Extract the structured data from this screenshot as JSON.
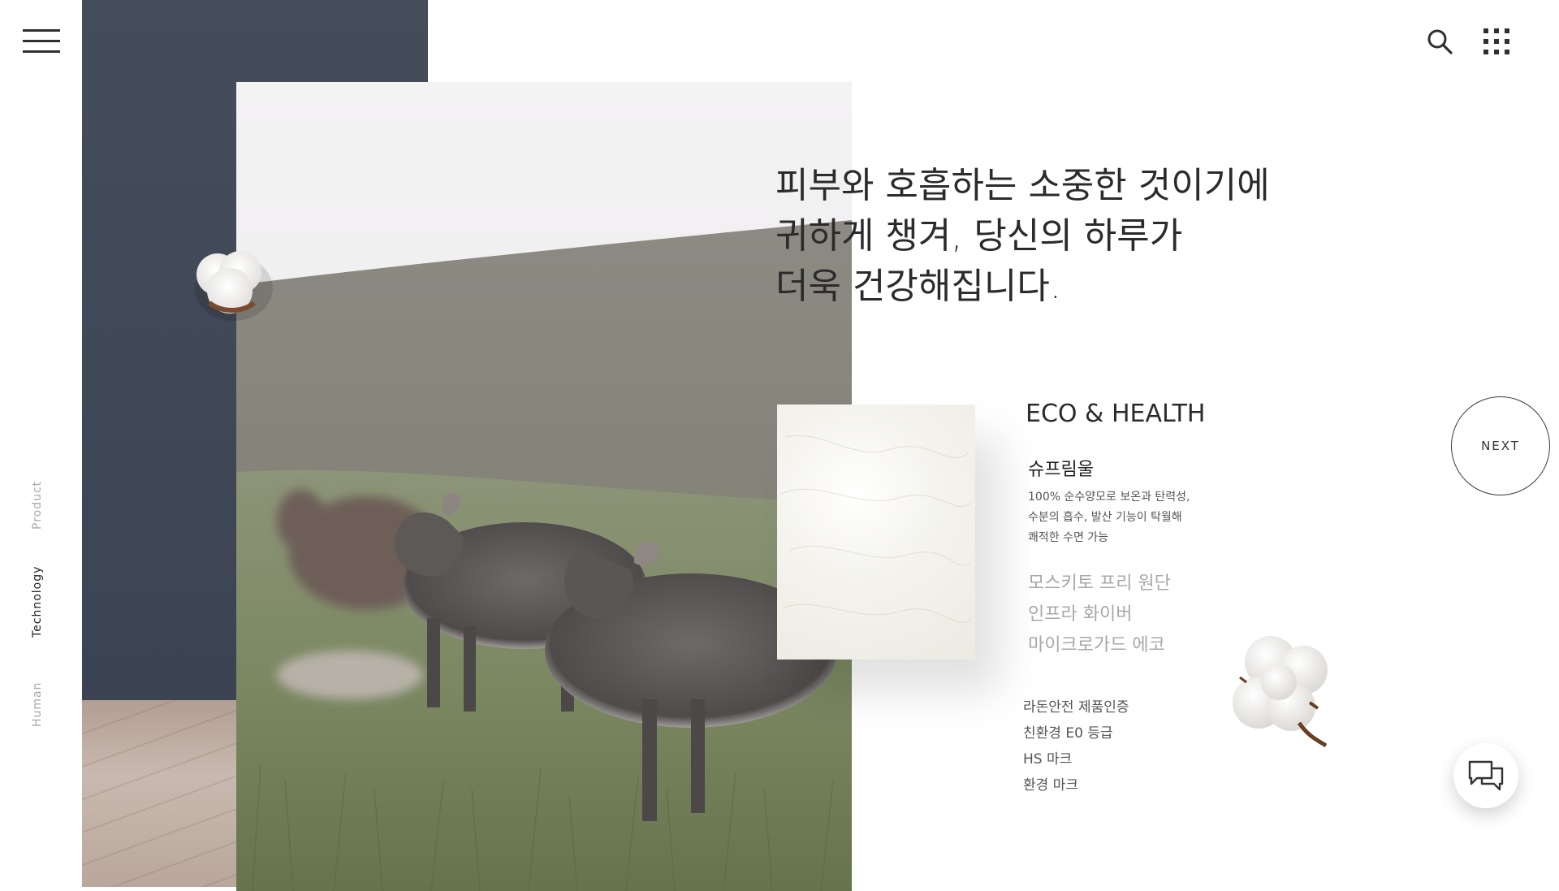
{
  "nav": {
    "menu_icon": "hamburger-menu-icon",
    "search_icon": "search-icon",
    "apps_icon": "grid-apps-icon"
  },
  "side_nav": {
    "items": [
      {
        "label": "Product",
        "active": false
      },
      {
        "label": "Technology",
        "active": true
      },
      {
        "label": "Human",
        "active": false
      }
    ]
  },
  "headline": {
    "line1": "피부와 호흡하는 소중한 것이기에",
    "line2": "귀하게 챙겨, 당신의 하루가",
    "line3": "더욱 건강해집니다."
  },
  "eco": {
    "title": "ECO & HEALTH",
    "active_feature": "슈프림울",
    "description": [
      "100% 순수양모로 보온과 탄력성,",
      "수분의 흡수, 발산 기능이 탁월해",
      "쾌적한 수면 가능"
    ],
    "features": [
      "모스키토 프리 원단",
      "인프라 화이버",
      "마이크로가드 에코"
    ],
    "certifications": [
      "라돈안전 제품인증",
      "친환경 E0 등급",
      "HS 마크",
      "환경 마크"
    ]
  },
  "next_button": {
    "label": "NEXT"
  },
  "chat": {
    "icon": "chat-bubbles-icon"
  },
  "colors": {
    "dark_panel": "#3f4654",
    "text_primary": "#2b2b2b",
    "text_muted": "#a8a8a8"
  }
}
